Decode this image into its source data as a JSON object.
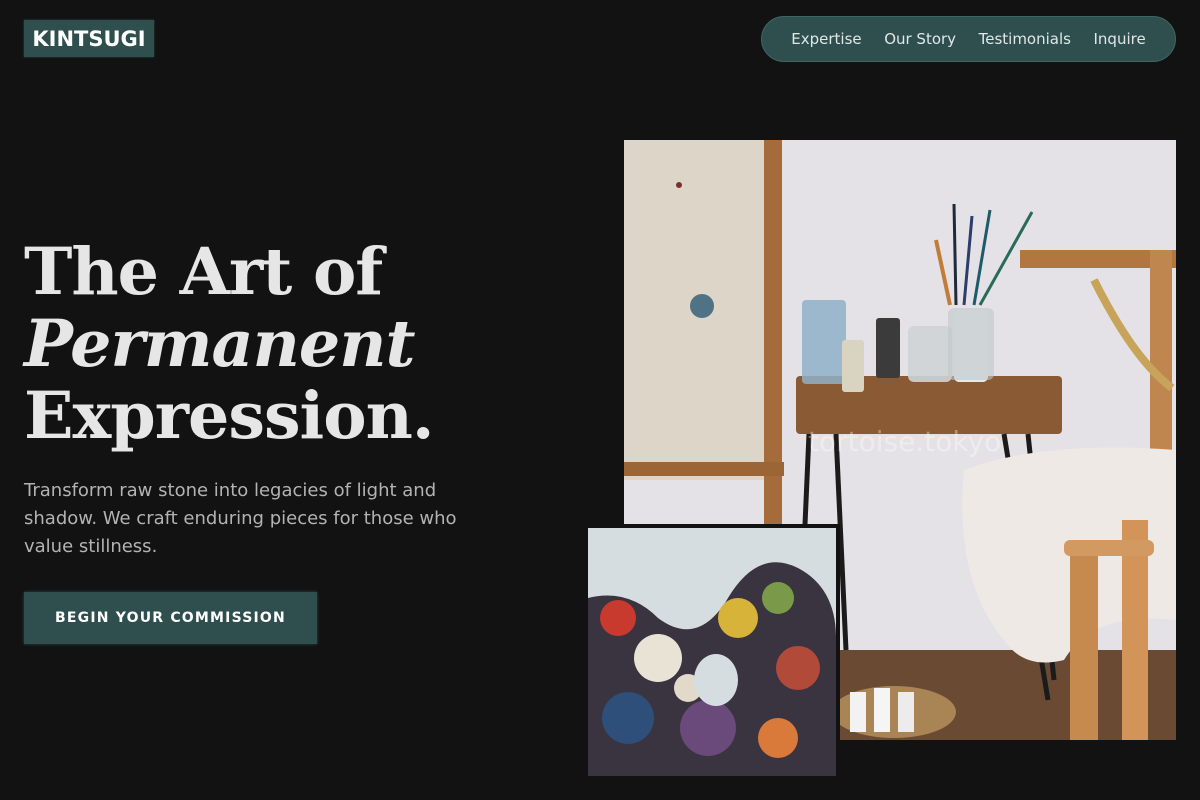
{
  "brand": {
    "logo": "KINTSUGI"
  },
  "nav": {
    "items": [
      "Expertise",
      "Our Story",
      "Testimonials",
      "Inquire"
    ]
  },
  "hero": {
    "title_line1": "The Art of",
    "title_line2": "Permanent",
    "title_line3": "Expression.",
    "subtitle": "Transform raw stone into legacies of light and shadow. We craft enduring pieces for those who value stillness.",
    "cta_label": "BEGIN YOUR COMMISSION"
  },
  "images": {
    "main_watermark": "tortoise.tokyo",
    "main_icon": "studio-photo-icon",
    "inset_icon": "paint-palette-icon"
  },
  "colors": {
    "background": "#121212",
    "accent": "#2f4f4f",
    "text": "#e6e6e6",
    "muted": "#b3b3b3"
  }
}
